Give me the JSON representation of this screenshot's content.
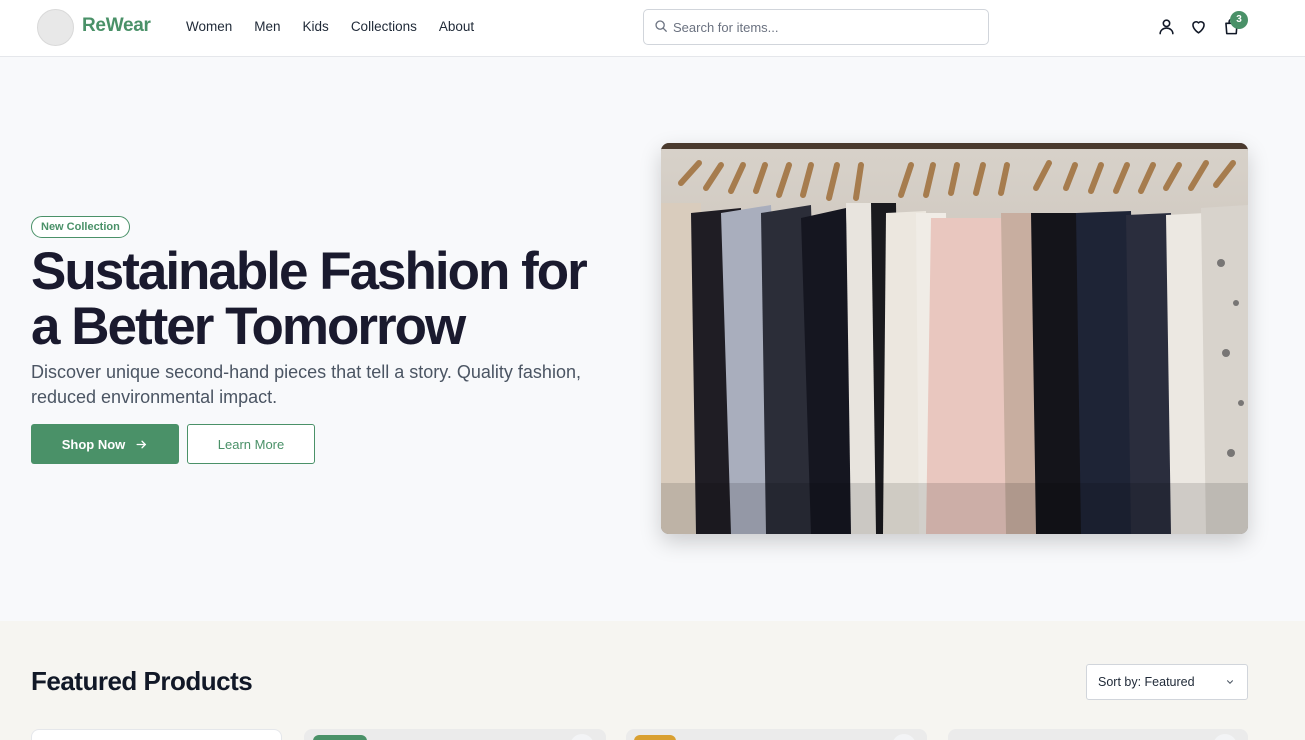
{
  "brand": {
    "name": "ReWear",
    "accent": "#4a9168"
  },
  "nav": [
    {
      "label": "Women"
    },
    {
      "label": "Men"
    },
    {
      "label": "Kids"
    },
    {
      "label": "Collections"
    },
    {
      "label": "About"
    }
  ],
  "search": {
    "placeholder": "Search for items..."
  },
  "header_icons": [
    "user-icon",
    "heart-icon",
    "shopping-bag-icon"
  ],
  "cart": {
    "count": "3"
  },
  "hero": {
    "badge": "New Collection",
    "title": "Sustainable Fashion for a Better Tomorrow",
    "subtitle": "Discover unique second-hand pieces that tell a story. Quality fashion, reduced environmental impact.",
    "primary_button": "Shop Now",
    "secondary_button": "Learn More"
  },
  "featured": {
    "title": "Featured Products",
    "sort_label": "Sort by: Featured"
  }
}
